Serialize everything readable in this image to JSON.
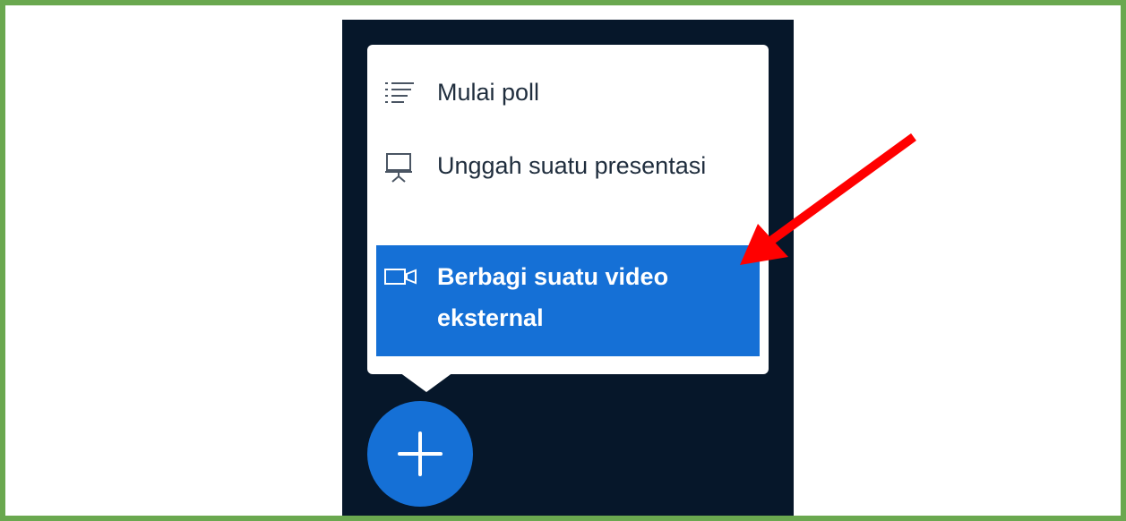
{
  "menu": {
    "items": [
      {
        "label": "Mulai poll",
        "icon": "poll-list-icon"
      },
      {
        "label": "Unggah suatu presentasi",
        "icon": "presentation-icon"
      },
      {
        "label": "Berbagi suatu video eksternal",
        "icon": "video-icon",
        "selected": true
      }
    ]
  },
  "fab": {
    "icon": "plus-icon"
  },
  "annotation": {
    "icon": "red-arrow-icon",
    "color": "#ff0000"
  },
  "colors": {
    "frame_border": "#6aa84f",
    "panel_background": "#06172a",
    "accent": "#1570d6",
    "menu_text": "#1f2d3d"
  }
}
